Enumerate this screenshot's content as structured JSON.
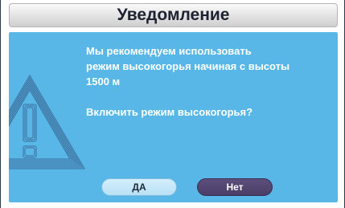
{
  "dialog": {
    "title": "Уведомление",
    "message": "Мы рекомендуем использовать\nрежим высокогорья начиная с высоты\n1500 м",
    "question": "Включить режим высокогорья?",
    "icon": "warning-triangle-icon",
    "buttons": {
      "yes_label": "ДА",
      "no_label": "Нет"
    }
  },
  "colors": {
    "panel": "#58b7e6",
    "yes_button": "#c4e7f8",
    "no_button": "#544572",
    "title_text": "#1c2230"
  }
}
